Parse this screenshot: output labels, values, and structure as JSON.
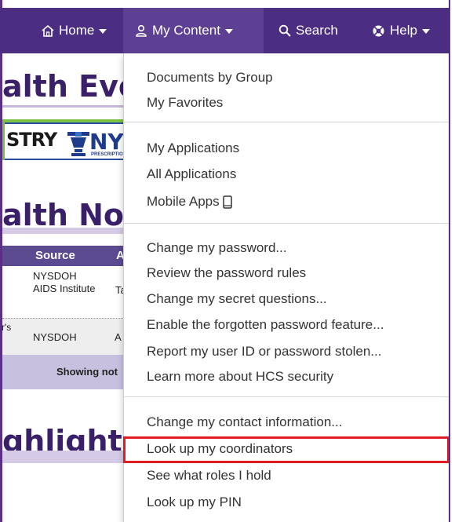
{
  "navbar": {
    "items": [
      {
        "label": "Home",
        "icon": "home-icon"
      },
      {
        "label": "My Content",
        "icon": "user-icon",
        "active": true
      },
      {
        "label": "Search",
        "icon": "search-icon"
      },
      {
        "label": "Help",
        "icon": "lifebuoy-icon"
      }
    ],
    "colors": {
      "background": "#4b2d82",
      "active": "#5d3f93"
    }
  },
  "page": {
    "heading_1": "alth Eve",
    "heading_2": "alth No",
    "heading_3": "ghlight",
    "banner": {
      "text": "STRY",
      "ny": "NY",
      "small": "PRESCRIPTIO"
    },
    "table": {
      "headers": [
        "Source",
        "A"
      ],
      "rows": [
        {
          "pre": "",
          "source": "NYSDOH AIDS Institute",
          "col2": "Ta"
        },
        {
          "pre": "r's",
          "source": "NYSDOH",
          "col2": "A"
        }
      ],
      "footer": "Showing not"
    }
  },
  "dropdown": {
    "groups": [
      [
        "Documents by Group",
        "My Favorites"
      ],
      [
        "My Applications",
        "All Applications",
        "Mobile Apps"
      ],
      [
        "Change my password...",
        "Review the password rules",
        "Change my secret questions...",
        "Enable the forgotten password feature...",
        "Report my user ID or password stolen...",
        "Learn more about HCS security"
      ],
      [
        "Change my contact information...",
        "Look up my coordinators",
        "See what roles I hold",
        "Look up my PIN"
      ]
    ],
    "highlighted": "Look up my coordinators",
    "highlight_color": "#e21b24"
  }
}
